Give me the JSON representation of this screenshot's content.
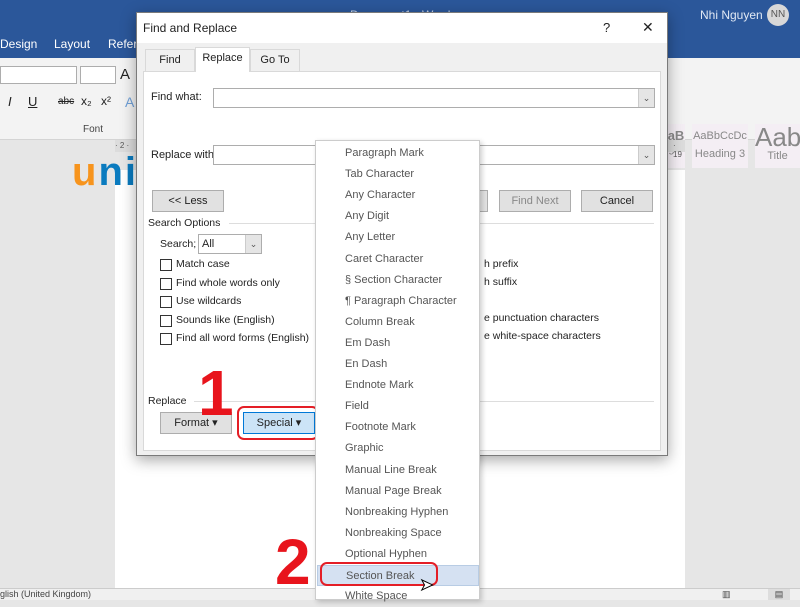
{
  "word": {
    "doc_title": "Document1 - Word",
    "user": "Nhi Nguyen",
    "avatar": "NN",
    "ribbon_tabs": [
      "Design",
      "Layout",
      "Refere"
    ],
    "font_group": "Font",
    "styles": [
      {
        "preview": "aB",
        "label": "g 2"
      },
      {
        "preview": "AaBbCcDc",
        "label": "Heading 3"
      },
      {
        "preview": "Aab",
        "label": "Title"
      }
    ],
    "ruler_left": "· 2 ·",
    "ruler_right": "· 19",
    "status": "glish (United Kingdom)"
  },
  "logo": {
    "text": "unica"
  },
  "dialog": {
    "title": "Find and Replace",
    "help": "?",
    "close": "✕",
    "tabs": [
      {
        "label": "Find",
        "active": false
      },
      {
        "label": "Replace",
        "active": true
      },
      {
        "label": "Go To",
        "active": false
      }
    ],
    "find_label": "Find what:",
    "find_value": "",
    "replace_label": "Replace with:",
    "replace_value": "",
    "less_button": "<< Less",
    "find_next": "Find Next",
    "cancel": "Cancel",
    "search_options": "Search Options",
    "search_label": "Search;",
    "search_value": "All",
    "options_left": [
      {
        "label": "Match case",
        "checked": false
      },
      {
        "label": "Find whole words only",
        "checked": false
      },
      {
        "label": "Use wildcards",
        "checked": false
      },
      {
        "label": "Sounds like (English)",
        "checked": false
      },
      {
        "label": "Find all word forms (English)",
        "checked": false
      }
    ],
    "options_right": [
      "h prefix",
      "h suffix",
      "e punctuation characters",
      "e white-space characters"
    ],
    "replace_section": "Replace",
    "format_button": "Format ▾",
    "special_button": "Special ▾"
  },
  "special_menu": {
    "items": [
      "Paragraph Mark",
      "Tab Character",
      "Any Character",
      "Any Digit",
      "Any Letter",
      "Caret Character",
      "§ Section Character",
      "¶ Paragraph Character",
      "Column Break",
      "Em Dash",
      "En Dash",
      "Endnote Mark",
      "Field",
      "Footnote Mark",
      "Graphic",
      "Manual Line Break",
      "Manual Page Break",
      "Nonbreaking Hyphen",
      "Nonbreaking Space",
      "Optional Hyphen",
      "Section Break",
      "White Space"
    ],
    "selected": "Section Break"
  },
  "annotations": {
    "step1": "1",
    "step2": "2",
    "highlight_color": "#e41e26"
  }
}
